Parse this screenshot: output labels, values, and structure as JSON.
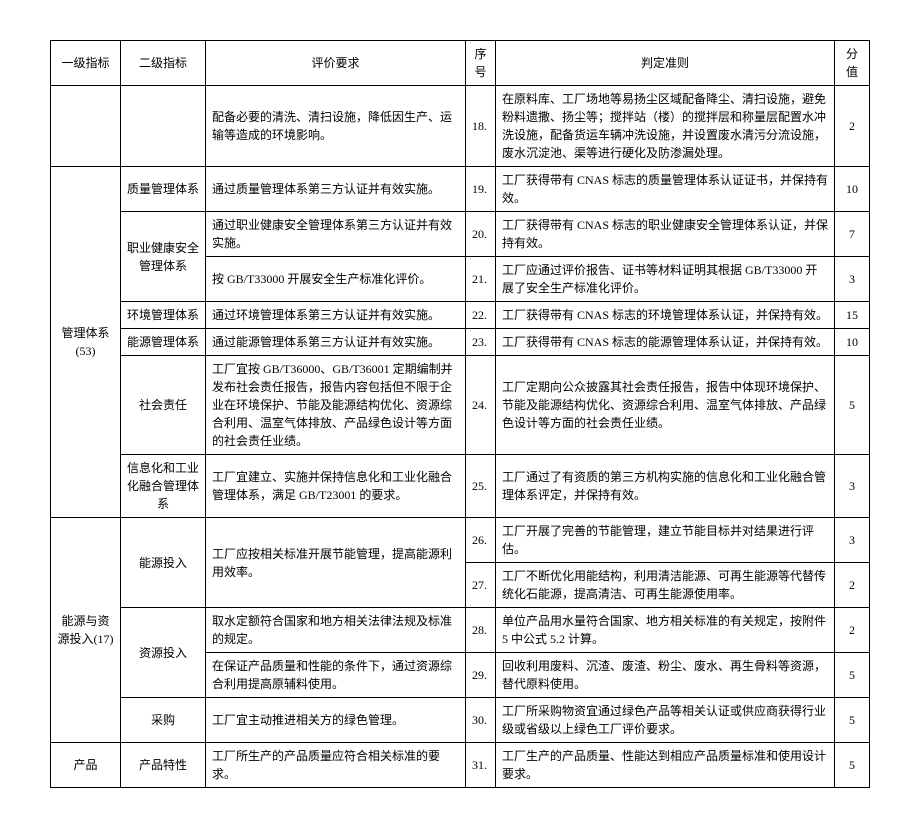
{
  "headers": {
    "lvl1": "一级指标",
    "lvl2": "二级指标",
    "req": "评价要求",
    "seq": "序号",
    "crit": "判定准则",
    "score": "分值"
  },
  "rows": [
    {
      "lvl1": "",
      "lvl2": "",
      "req": "配备必要的清洗、清扫设施，降低因生产、运输等造成的环境影响。",
      "seq": "18.",
      "crit": "在原料库、工厂场地等易扬尘区域配备降尘、清扫设施，避免粉料遗撒、扬尘等；搅拌站（楼）的搅拌层和称量层配置水冲洗设施，配备货运车辆冲洗设施，并设置废水清污分流设施，废水沉淀池、渠等进行硬化及防渗漏处理。",
      "score": "2"
    },
    {
      "lvl1": "管理体系(53)",
      "lvl2": "质量管理体系",
      "req": "通过质量管理体系第三方认证并有效实施。",
      "seq": "19.",
      "crit": "工厂获得带有 CNAS 标志的质量管理体系认证证书，并保持有效。",
      "score": "10"
    },
    {
      "lvl2": "职业健康安全管理体系",
      "req": "通过职业健康安全管理体系第三方认证并有效实施。",
      "seq": "20.",
      "crit": "工厂获得带有 CNAS 标志的职业健康安全管理体系认证，并保持有效。",
      "score": "7"
    },
    {
      "req": "按 GB/T33000 开展安全生产标准化评价。",
      "seq": "21.",
      "crit": "工厂应通过评价报告、证书等材料证明其根据 GB/T33000 开展了安全生产标准化评价。",
      "score": "3"
    },
    {
      "lvl2": "环境管理体系",
      "req": "通过环境管理体系第三方认证并有效实施。",
      "seq": "22.",
      "crit": "工厂获得带有 CNAS 标志的环境管理体系认证，并保持有效。",
      "score": "15"
    },
    {
      "lvl2": "能源管理体系",
      "req": "通过能源管理体系第三方认证并有效实施。",
      "seq": "23.",
      "crit": "工厂获得带有 CNAS 标志的能源管理体系认证，并保持有效。",
      "score": "10"
    },
    {
      "lvl2": "社会责任",
      "req": "工厂宜按 GB/T36000、GB/T36001 定期编制并发布社会责任报告，报告内容包括但不限于企业在环境保护、节能及能源结构优化、资源综合利用、温室气体排放、产品绿色设计等方面的社会责任业绩。",
      "seq": "24.",
      "crit": "工厂定期向公众披露其社会责任报告，报告中体现环境保护、节能及能源结构优化、资源综合利用、温室气体排放、产品绿色设计等方面的社会责任业绩。",
      "score": "5"
    },
    {
      "lvl2": "信息化和工业化融合管理体系",
      "req": "工厂宜建立、实施并保持信息化和工业化融合管理体系，满足 GB/T23001 的要求。",
      "seq": "25.",
      "crit": "工厂通过了有资质的第三方机构实施的信息化和工业化融合管理体系评定，并保持有效。",
      "score": "3"
    },
    {
      "lvl1": "能源与资源投入(17)",
      "lvl2": "能源投入",
      "req": "工厂应按相关标准开展节能管理，提高能源利用效率。",
      "seq": "26.",
      "crit": "工厂开展了完善的节能管理，建立节能目标并对结果进行评估。",
      "score": "3"
    },
    {
      "seq": "27.",
      "crit": "工厂不断优化用能结构，利用清洁能源、可再生能源等代替传统化石能源，提高清洁、可再生能源使用率。",
      "score": "2"
    },
    {
      "lvl2": "资源投入",
      "req": "取水定额符合国家和地方相关法律法规及标准的规定。",
      "seq": "28.",
      "crit": "单位产品用水量符合国家、地方相关标准的有关规定，按附件 5 中公式 5.2 计算。",
      "score": "2"
    },
    {
      "req": "在保证产品质量和性能的条件下，通过资源综合利用提高原辅料使用。",
      "seq": "29.",
      "crit": "回收利用废料、沉渣、废渣、粉尘、废水、再生骨料等资源，替代原料使用。",
      "score": "5"
    },
    {
      "lvl2": "采购",
      "req": "工厂宜主动推进相关方的绿色管理。",
      "seq": "30.",
      "crit": "工厂所采购物资宜通过绿色产品等相关认证或供应商获得行业级或省级以上绿色工厂评价要求。",
      "score": "5"
    },
    {
      "lvl1": "产品",
      "lvl2": "产品特性",
      "req": "工厂所生产的产品质量应符合相关标准的要求。",
      "seq": "31.",
      "crit": "工厂生产的产品质量、性能达到相应产品质量标准和使用设计要求。",
      "score": "5"
    }
  ]
}
